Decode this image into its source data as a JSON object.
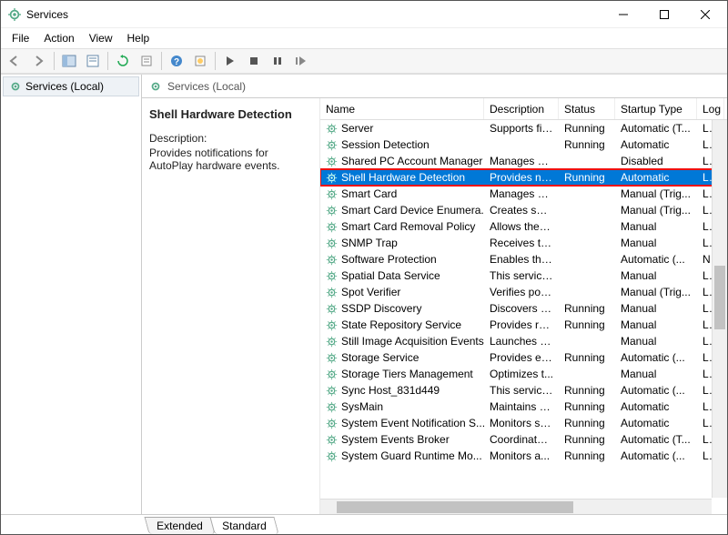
{
  "window": {
    "title": "Services"
  },
  "menu": {
    "file": "File",
    "action": "Action",
    "view": "View",
    "help": "Help"
  },
  "tree": {
    "root": "Services (Local)"
  },
  "rheader": {
    "title": "Services (Local)"
  },
  "details": {
    "name": "Shell Hardware Detection",
    "desc_label": "Description:",
    "desc": "Provides notifications for AutoPlay hardware events."
  },
  "columns": {
    "name": "Name",
    "desc": "Description",
    "status": "Status",
    "startup": "Startup Type",
    "logon": "Log"
  },
  "tabs": {
    "extended": "Extended",
    "standard": "Standard"
  },
  "services": [
    {
      "name": "Server",
      "desc": "Supports fil...",
      "status": "Running",
      "startup": "Automatic (T...",
      "logon": "Loc"
    },
    {
      "name": "Session Detection",
      "desc": "",
      "status": "Running",
      "startup": "Automatic",
      "logon": "Loc"
    },
    {
      "name": "Shared PC Account Manager",
      "desc": "Manages pr...",
      "status": "",
      "startup": "Disabled",
      "logon": "Loc"
    },
    {
      "name": "Shell Hardware Detection",
      "desc": "Provides no...",
      "status": "Running",
      "startup": "Automatic",
      "logon": "Loc",
      "selected": true
    },
    {
      "name": "Smart Card",
      "desc": "Manages ac...",
      "status": "",
      "startup": "Manual (Trig...",
      "logon": "Loc"
    },
    {
      "name": "Smart Card Device Enumera...",
      "desc": "Creates soft...",
      "status": "",
      "startup": "Manual (Trig...",
      "logon": "Loc"
    },
    {
      "name": "Smart Card Removal Policy",
      "desc": "Allows the s...",
      "status": "",
      "startup": "Manual",
      "logon": "Loc"
    },
    {
      "name": "SNMP Trap",
      "desc": "Receives tra...",
      "status": "",
      "startup": "Manual",
      "logon": "Loc"
    },
    {
      "name": "Software Protection",
      "desc": "Enables the ...",
      "status": "",
      "startup": "Automatic (...",
      "logon": "Net"
    },
    {
      "name": "Spatial Data Service",
      "desc": "This service ...",
      "status": "",
      "startup": "Manual",
      "logon": "Loc"
    },
    {
      "name": "Spot Verifier",
      "desc": "Verifies pote...",
      "status": "",
      "startup": "Manual (Trig...",
      "logon": "Loc"
    },
    {
      "name": "SSDP Discovery",
      "desc": "Discovers n...",
      "status": "Running",
      "startup": "Manual",
      "logon": "Loc"
    },
    {
      "name": "State Repository Service",
      "desc": "Provides re...",
      "status": "Running",
      "startup": "Manual",
      "logon": "Loc"
    },
    {
      "name": "Still Image Acquisition Events",
      "desc": "Launches a...",
      "status": "",
      "startup": "Manual",
      "logon": "Loc"
    },
    {
      "name": "Storage Service",
      "desc": "Provides en...",
      "status": "Running",
      "startup": "Automatic (...",
      "logon": "Loc"
    },
    {
      "name": "Storage Tiers Management",
      "desc": "Optimizes t...",
      "status": "",
      "startup": "Manual",
      "logon": "Loc"
    },
    {
      "name": "Sync Host_831d449",
      "desc": "This service ...",
      "status": "Running",
      "startup": "Automatic (...",
      "logon": "Loc"
    },
    {
      "name": "SysMain",
      "desc": "Maintains a...",
      "status": "Running",
      "startup": "Automatic",
      "logon": "Loc"
    },
    {
      "name": "System Event Notification S...",
      "desc": "Monitors sy...",
      "status": "Running",
      "startup": "Automatic",
      "logon": "Loc"
    },
    {
      "name": "System Events Broker",
      "desc": "Coordinates...",
      "status": "Running",
      "startup": "Automatic (T...",
      "logon": "Loc"
    },
    {
      "name": "System Guard Runtime Mo...",
      "desc": "Monitors a...",
      "status": "Running",
      "startup": "Automatic (...",
      "logon": "Loc"
    }
  ]
}
